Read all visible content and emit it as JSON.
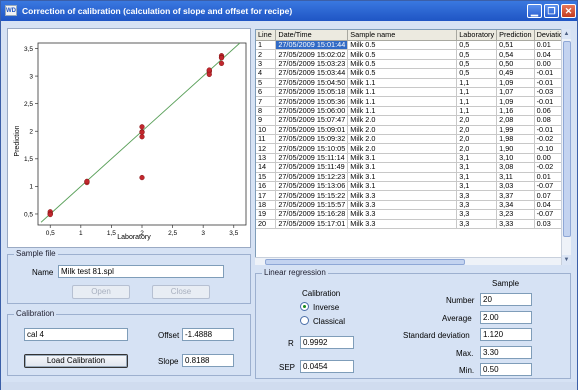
{
  "window": {
    "title": "Correction of calibration (calculation of slope and offset for recipe)",
    "app_icon_text": "WD",
    "controls": [
      "minimize-icon",
      "maximize-icon",
      "close-icon"
    ]
  },
  "chart_data": {
    "type": "scatter",
    "xlabel": "Laboratory",
    "ylabel": "Prediction",
    "xlim": [
      0.3,
      3.7
    ],
    "ylim": [
      0.3,
      3.6
    ],
    "x_ticks": [
      "0,5",
      "1",
      "1,5",
      "2",
      "2,5",
      "3",
      "3,5"
    ],
    "y_ticks": [
      "0,5",
      "1",
      "1,5",
      "2",
      "2,5",
      "3",
      "3,5"
    ],
    "x_tick_values": [
      0.5,
      1,
      1.5,
      2,
      2.5,
      3,
      3.5
    ],
    "y_tick_values": [
      0.5,
      1,
      1.5,
      2,
      2.5,
      3,
      3.5
    ],
    "grid": false,
    "colors": {
      "points": "#c1272d",
      "line": "#5aa05a"
    },
    "series": [
      {
        "x": [
          0.5,
          0.5,
          0.5,
          0.5,
          1.1,
          1.1,
          1.1,
          2.0,
          2.0,
          2.0,
          2.0,
          2.0,
          3.1,
          3.1,
          3.1,
          3.1,
          3.3,
          3.3,
          3.3,
          3.3
        ],
        "y": [
          0.51,
          0.54,
          0.5,
          0.49,
          1.09,
          1.07,
          1.09,
          2.08,
          1.99,
          1.98,
          1.9,
          1.16,
          3.1,
          3.08,
          3.11,
          3.03,
          3.37,
          3.34,
          3.23,
          3.33
        ]
      }
    ],
    "fit_line": {
      "x": [
        0.35,
        3.6
      ],
      "y": [
        0.35,
        3.6
      ]
    }
  },
  "sample_file": {
    "legend": "Sample file",
    "name_label": "Name",
    "name_value": "Milk test 81.spl",
    "open_label": "Open",
    "close_label": "Close"
  },
  "calibration": {
    "legend": "Calibration",
    "name_value": "cal 4",
    "offset_label": "Offset",
    "offset_value": "-1.4888",
    "slope_label": "Slope",
    "slope_value": "0.8188",
    "load_label": "Load Calibration"
  },
  "table": {
    "columns": [
      "Line",
      "Date/Time",
      "Sample name",
      "Laboratory",
      "Prediction",
      "Deviation"
    ],
    "rows": [
      [
        "1",
        "27/05/2009 15:01:44",
        "Milk 0.5",
        "0,5",
        "0,51",
        "0.01"
      ],
      [
        "2",
        "27/05/2009 15:02:02",
        "Milk 0.5",
        "0,5",
        "0,54",
        "0.04"
      ],
      [
        "3",
        "27/05/2009 15:03:23",
        "Milk 0.5",
        "0,5",
        "0,50",
        "0.00"
      ],
      [
        "4",
        "27/05/2009 15:03:44",
        "Milk 0.5",
        "0,5",
        "0,49",
        "-0.01"
      ],
      [
        "5",
        "27/05/2009 15:04:50",
        "Milk 1.1",
        "1,1",
        "1,09",
        "-0.01"
      ],
      [
        "6",
        "27/05/2009 15:05:18",
        "Milk 1.1",
        "1,1",
        "1,07",
        "-0.03"
      ],
      [
        "7",
        "27/05/2009 15:05:36",
        "Milk 1.1",
        "1,1",
        "1,09",
        "-0.01"
      ],
      [
        "8",
        "27/05/2009 15:06:00",
        "Milk 1.1",
        "1,1",
        "1,16",
        "0.06"
      ],
      [
        "9",
        "27/05/2009 15:07:47",
        "Milk 2.0",
        "2,0",
        "2,08",
        "0.08"
      ],
      [
        "10",
        "27/05/2009 15:09:01",
        "Milk 2.0",
        "2,0",
        "1,99",
        "-0.01"
      ],
      [
        "11",
        "27/05/2009 15:09:32",
        "Milk 2.0",
        "2,0",
        "1,98",
        "-0.02"
      ],
      [
        "12",
        "27/05/2009 15:10:05",
        "Milk 2.0",
        "2,0",
        "1,90",
        "-0.10"
      ],
      [
        "13",
        "27/05/2009 15:11:14",
        "Milk 3.1",
        "3,1",
        "3,10",
        "0.00"
      ],
      [
        "14",
        "27/05/2009 15:11:49",
        "Milk 3.1",
        "3,1",
        "3,08",
        "-0.02"
      ],
      [
        "15",
        "27/05/2009 15:12:23",
        "Milk 3.1",
        "3,1",
        "3,11",
        "0.01"
      ],
      [
        "16",
        "27/05/2009 15:13:06",
        "Milk 3.1",
        "3,1",
        "3,03",
        "-0.07"
      ],
      [
        "17",
        "27/05/2009 15:15:22",
        "Milk 3.3",
        "3,3",
        "3,37",
        "0.07"
      ],
      [
        "18",
        "27/05/2009 15:15:57",
        "Milk 3.3",
        "3,3",
        "3,34",
        "0.04"
      ],
      [
        "19",
        "27/05/2009 15:16:28",
        "Milk 3.3",
        "3,3",
        "3,23",
        "-0.07"
      ],
      [
        "20",
        "27/05/2009 15:17:01",
        "Milk 3.3",
        "3,3",
        "3,33",
        "0.03"
      ]
    ]
  },
  "regression": {
    "legend": "Linear regression",
    "calibration_label": "Calibration",
    "inverse_label": "Inverse",
    "classical_label": "Classical",
    "selected": "Inverse",
    "r_label": "R",
    "r_value": "0.9992",
    "sep_label": "SEP",
    "sep_value": "0.0454",
    "sample_header": "Sample",
    "number_label": "Number",
    "number_value": "20",
    "average_label": "Average",
    "average_value": "2.00",
    "std_label": "Standard deviation",
    "std_value": "1.120",
    "max_label": "Max.",
    "max_value": "3.30",
    "min_label": "Min.",
    "min_value": "0.50"
  }
}
